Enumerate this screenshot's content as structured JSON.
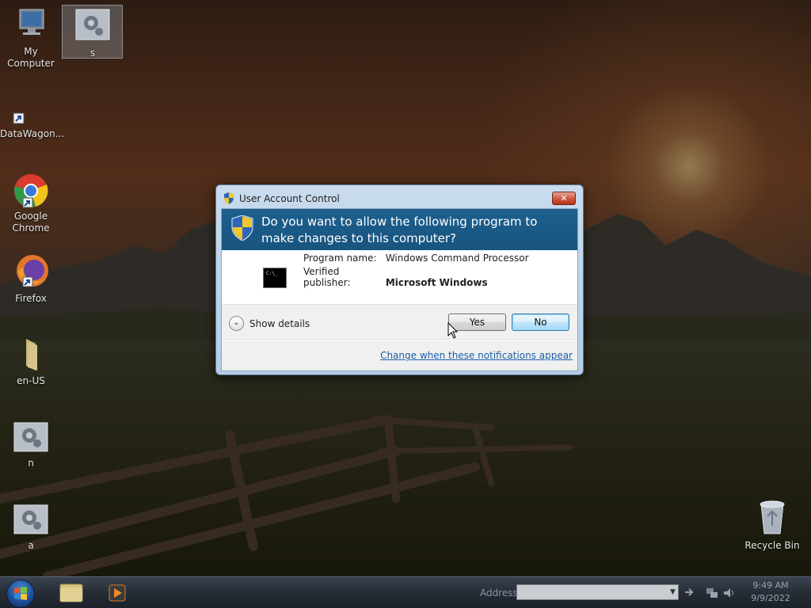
{
  "desktop": {
    "icons": [
      {
        "label": "My Computer"
      },
      {
        "label": "s"
      },
      {
        "label": "DataWagon..."
      },
      {
        "label": "Google Chrome"
      },
      {
        "label": "Firefox"
      },
      {
        "label": "en-US"
      },
      {
        "label": "n"
      },
      {
        "label": "a"
      },
      {
        "label": "Recycle Bin"
      }
    ]
  },
  "uac": {
    "title": "User Account Control",
    "close_label": "✕",
    "question": "Do you want to allow the following program to make changes to this computer?",
    "program_name_label": "Program name:",
    "program_name_value": "Windows Command Processor",
    "publisher_label": "Verified publisher:",
    "publisher_value": "Microsoft Windows",
    "cmd_icon_text": "C:\\_",
    "show_details_label": "Show details",
    "yes_label": "Yes",
    "no_label": "No",
    "change_link": "Change when these notifications appear"
  },
  "taskbar": {
    "address_label": "Address",
    "address_value": "",
    "clock_time": "9:49 AM",
    "clock_date": "9/9/2022"
  },
  "icons": {
    "start": "windows-start-icon",
    "explorer": "folder-icon",
    "media": "media-player-icon",
    "shield": "uac-shield-icon",
    "cursor": "mouse-pointer-icon"
  },
  "colors": {
    "uac_header": "#1d5f8e",
    "link": "#1a5fa8",
    "close_button": "#cf5c44"
  }
}
